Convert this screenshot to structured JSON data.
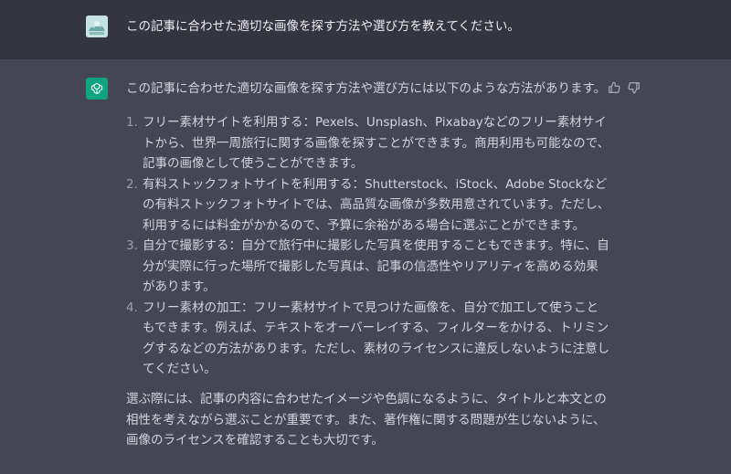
{
  "conversation": {
    "user_message": "この記事に合わせた適切な画像を探す方法や選び方を教えてください。",
    "assistant": {
      "intro": "この記事に合わせた適切な画像を探す方法や選び方には以下のような方法があります。",
      "items": [
        {
          "number": "1.",
          "text": "フリー素材サイトを利用する：Pexels、Unsplash、Pixabayなどのフリー素材サイトから、世界一周旅行に関する画像を探すことができます。商用利用も可能なので、記事の画像として使うことができます。"
        },
        {
          "number": "2.",
          "text": "有料ストックフォトサイトを利用する：Shutterstock、iStock、Adobe Stockなどの有料ストックフォトサイトでは、高品質な画像が多数用意されています。ただし、利用するには料金がかかるので、予算に余裕がある場合に選ぶことができます。"
        },
        {
          "number": "3.",
          "text": "自分で撮影する：自分で旅行中に撮影した写真を使用することもできます。特に、自分が実際に行った場所で撮影した写真は、記事の信憑性やリアリティを高める効果があります。"
        },
        {
          "number": "4.",
          "text": "フリー素材の加工：フリー素材サイトで見つけた画像を、自分で加工して使うこともできます。例えば、テキストをオーバーレイする、フィルターをかける、トリミングするなどの方法があります。ただし、素材のライセンスに違反しないように注意してください。"
        }
      ],
      "outro": "選ぶ際には、記事の内容に合わせたイメージや色調になるように、タイトルと本文との相性を考えながら選ぶことが重要です。また、著作権に関する問題が生じないように、画像のライセンスを確認することも大切です。"
    }
  },
  "colors": {
    "user_bg": "#343541",
    "assistant_bg": "#444654",
    "gpt_green": "#10a37f",
    "text": "#d1d5db"
  },
  "icons": [
    "user-avatar",
    "chatgpt-logo-icon",
    "thumbs-up-icon",
    "thumbs-down-icon"
  ]
}
